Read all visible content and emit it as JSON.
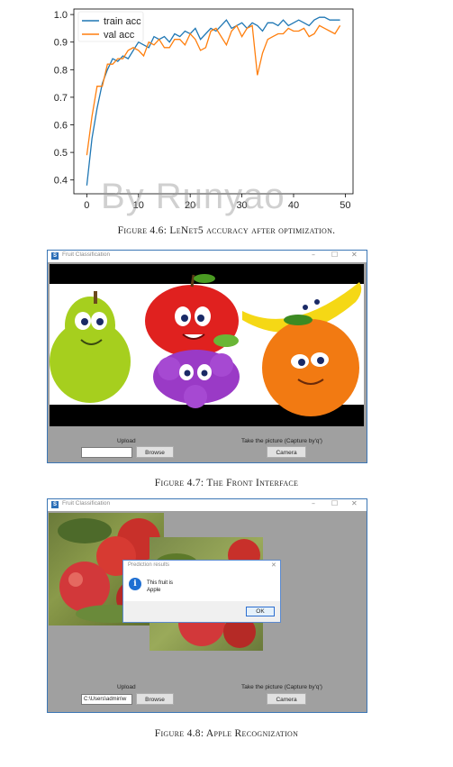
{
  "chart_data": {
    "type": "line",
    "x": [
      0,
      1,
      2,
      3,
      4,
      5,
      6,
      7,
      8,
      9,
      10,
      11,
      12,
      13,
      14,
      15,
      16,
      17,
      18,
      19,
      20,
      21,
      22,
      23,
      24,
      25,
      26,
      27,
      28,
      29,
      30,
      31,
      32,
      33,
      34,
      35,
      36,
      37,
      38,
      39,
      40,
      41,
      42,
      43,
      44,
      45,
      46,
      47,
      48,
      49
    ],
    "series": [
      {
        "name": "train acc",
        "color": "#1f77b4",
        "values": [
          0.38,
          0.55,
          0.66,
          0.75,
          0.8,
          0.84,
          0.83,
          0.85,
          0.84,
          0.87,
          0.9,
          0.89,
          0.88,
          0.92,
          0.91,
          0.92,
          0.9,
          0.93,
          0.92,
          0.94,
          0.93,
          0.95,
          0.91,
          0.93,
          0.95,
          0.94,
          0.96,
          0.98,
          0.95,
          0.96,
          0.97,
          0.95,
          0.97,
          0.96,
          0.94,
          0.97,
          0.97,
          0.96,
          0.98,
          0.96,
          0.97,
          0.98,
          0.97,
          0.96,
          0.98,
          0.99,
          0.99,
          0.98,
          0.98,
          0.98
        ]
      },
      {
        "name": "val acc",
        "color": "#ff7f0e",
        "values": [
          0.49,
          0.63,
          0.74,
          0.74,
          0.82,
          0.82,
          0.84,
          0.84,
          0.87,
          0.88,
          0.87,
          0.85,
          0.9,
          0.89,
          0.91,
          0.88,
          0.88,
          0.91,
          0.91,
          0.89,
          0.93,
          0.91,
          0.87,
          0.88,
          0.94,
          0.95,
          0.92,
          0.89,
          0.94,
          0.96,
          0.92,
          0.95,
          0.96,
          0.78,
          0.86,
          0.91,
          0.92,
          0.93,
          0.93,
          0.95,
          0.94,
          0.94,
          0.95,
          0.92,
          0.93,
          0.96,
          0.95,
          0.94,
          0.93,
          0.96
        ]
      }
    ],
    "title": "",
    "xlabel": "",
    "ylabel": "",
    "xlim": [
      -2.5,
      51.5
    ],
    "ylim": [
      0.35,
      1.02
    ],
    "xticks": [
      0,
      10,
      20,
      30,
      40,
      50
    ],
    "yticks": [
      0.4,
      0.5,
      0.6,
      0.7,
      0.8,
      0.9,
      1.0
    ],
    "legend": "top-left",
    "grid": false
  },
  "watermark": "By Runyao",
  "captions": {
    "fig46": "Figure 4.6: LeNet5 accuracy after optimization.",
    "fig47": "Figure 4.7: The Front Interface",
    "fig48": "Figure 4.8: Apple Recognization"
  },
  "window1": {
    "icon": "S",
    "title": "Fruit Classification",
    "controls": {
      "minimize": "–",
      "maximize": "☐",
      "close": "✕"
    },
    "upload_label": "Upload",
    "upload_value": "",
    "browse_button": "Browse",
    "camera_label": "Take the picture  (Capture by'q')",
    "camera_button": "Camera"
  },
  "window2": {
    "icon": "S",
    "title": "Fruit Classification",
    "controls": {
      "minimize": "–",
      "maximize": "☐",
      "close": "✕"
    },
    "upload_label": "Upload",
    "upload_value": "C:\\Users\\admin\\w",
    "browse_button": "Browse",
    "camera_label": "Take the picture  (Capture by'q')",
    "camera_button": "Camera",
    "dialog": {
      "title": "Prediction results",
      "close": "✕",
      "info_icon": "i",
      "line1": "This fruit is",
      "line2": "Apple",
      "ok_button": "OK"
    }
  },
  "colors": {
    "accent": "#3b76b5",
    "train": "#1f77b4",
    "val": "#ff7f0e"
  }
}
